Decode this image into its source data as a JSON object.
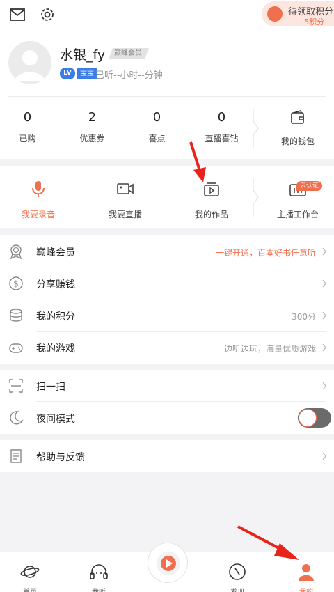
{
  "header": {
    "points_title": "待领取积分",
    "points_bonus": "+5积分"
  },
  "profile": {
    "username": "水银_fy",
    "vip_tag": "巅峰会员",
    "lv_text": "LV",
    "level_name": "宝宝",
    "listened": "已听--小时--分钟"
  },
  "stats": [
    {
      "value": "0",
      "label": "已购"
    },
    {
      "value": "2",
      "label": "优惠券"
    },
    {
      "value": "0",
      "label": "喜点"
    },
    {
      "value": "0",
      "label": "直播喜钻"
    }
  ],
  "wallet_label": "我的钱包",
  "actions": [
    {
      "label": "我要录音"
    },
    {
      "label": "我要直播"
    },
    {
      "label": "我的作品"
    },
    {
      "label": "主播工作台"
    }
  ],
  "cert_badge": "去认证",
  "menu1": [
    {
      "label": "巅峰会员",
      "right": "一键开通，百本好书任意听"
    },
    {
      "label": "分享赚钱",
      "right": ""
    },
    {
      "label": "我的积分",
      "right": "300分"
    },
    {
      "label": "我的游戏",
      "right": "边听边玩，海量优质游戏"
    }
  ],
  "menu2": [
    {
      "label": "扫一扫"
    },
    {
      "label": "夜间模式"
    }
  ],
  "menu3": [
    {
      "label": "帮助与反馈"
    }
  ],
  "tabs": [
    {
      "label": "首页"
    },
    {
      "label": "我听"
    },
    {
      "label": "发现"
    },
    {
      "label": "我的"
    }
  ],
  "colors": {
    "accent": "#f0704d",
    "badge_blue": "#3a7de6",
    "annotation_red": "#e8231c"
  }
}
